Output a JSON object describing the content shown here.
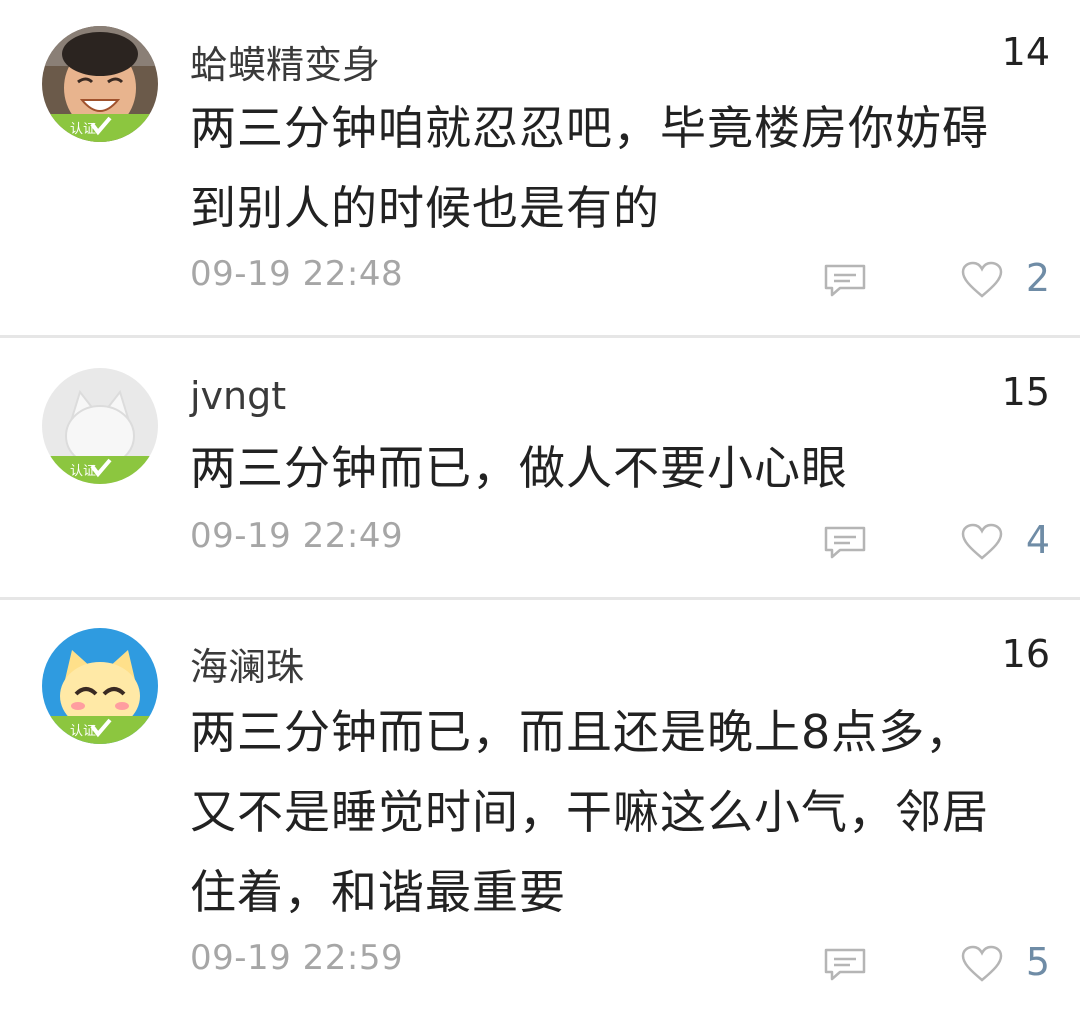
{
  "comments": [
    {
      "username": "蛤蟆精变身",
      "floor": "14",
      "content_lines": [
        "两三分钟咱就忍忍吧，毕竟楼房你妨碍",
        "到别人的时候也是有的"
      ],
      "timestamp": "09-19 22:48",
      "likes": "2",
      "avatar": "baby-photo-avatar",
      "badge": "认证"
    },
    {
      "username": "jvngt",
      "floor": "15",
      "content_lines": [
        "两三分钟而已，做人不要小心眼"
      ],
      "timestamp": "09-19 22:49",
      "likes": "4",
      "avatar": "default-cat-avatar",
      "badge": "认证"
    },
    {
      "username": "海澜珠",
      "floor": "16",
      "content_lines": [
        "两三分钟而已，而且还是晚上8点多，",
        "又不是睡觉时间，干嘛这么小气，邻居",
        "住着，和谐最重要"
      ],
      "timestamp": "09-19 22:59",
      "likes": "5",
      "avatar": "cartoon-cat-avatar",
      "badge": "认证"
    }
  ],
  "colors": {
    "badge_green": "#8cc63f",
    "like_count": "#6f8ca6",
    "timestamp": "#a6a6a6",
    "icon_gray": "#b5b5b5"
  }
}
